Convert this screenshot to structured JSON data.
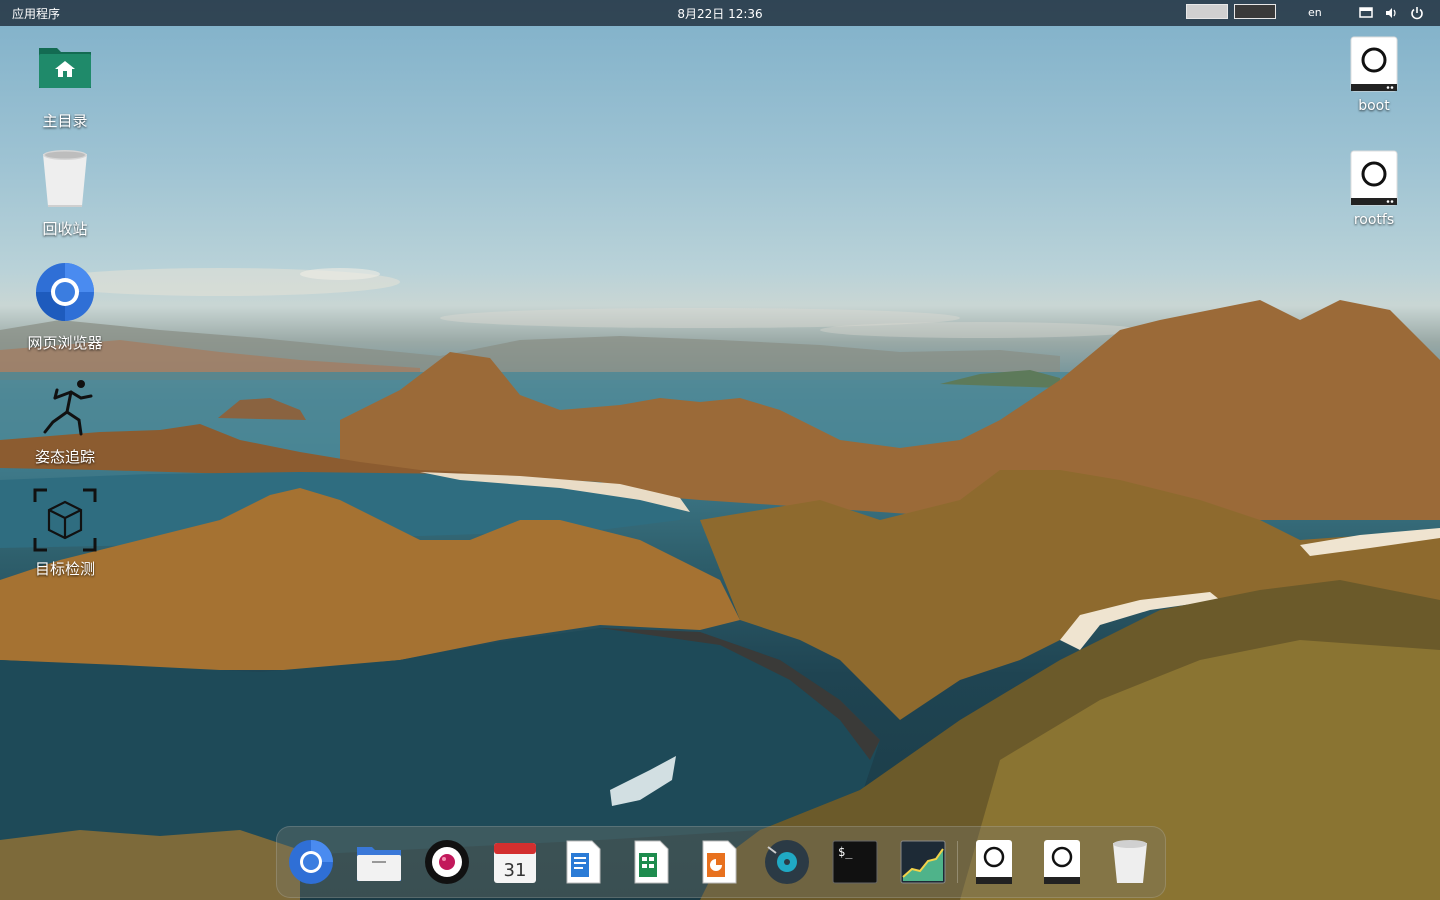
{
  "topbar": {
    "applications_label": "应用程序",
    "clock": "8月22日  12:36",
    "language": "en",
    "workspaces": [
      "workspace-1",
      "workspace-2"
    ],
    "tray_icons": [
      "display-icon",
      "volume-icon",
      "power-icon"
    ]
  },
  "desktop_icons_left": [
    {
      "label": "主目录",
      "icon": "home-folder-icon"
    },
    {
      "label": "回收站",
      "icon": "trash-icon"
    },
    {
      "label": "网页浏览器",
      "icon": "chromium-icon"
    },
    {
      "label": "姿态追踪",
      "icon": "pose-tracking-icon"
    },
    {
      "label": "目标检测",
      "icon": "object-detection-icon"
    }
  ],
  "desktop_icons_right": [
    {
      "label": "boot",
      "icon": "drive-icon"
    },
    {
      "label": "rootfs",
      "icon": "drive-icon"
    }
  ],
  "dock": {
    "items": [
      "chromium-icon",
      "file-manager-icon",
      "raspberry-camera-icon",
      "calendar-icon",
      "writer-icon",
      "calc-icon",
      "impress-icon",
      "music-player-icon",
      "terminal-icon",
      "system-monitor-icon",
      "drive-icon",
      "drive-icon",
      "trash-icon"
    ],
    "calendar_day": "31",
    "terminal_prompt": "$_"
  },
  "colors": {
    "topbar_bg": "#121c28",
    "folder_green": "#1f8a6a",
    "chromium_blue": "#3b7de0"
  }
}
